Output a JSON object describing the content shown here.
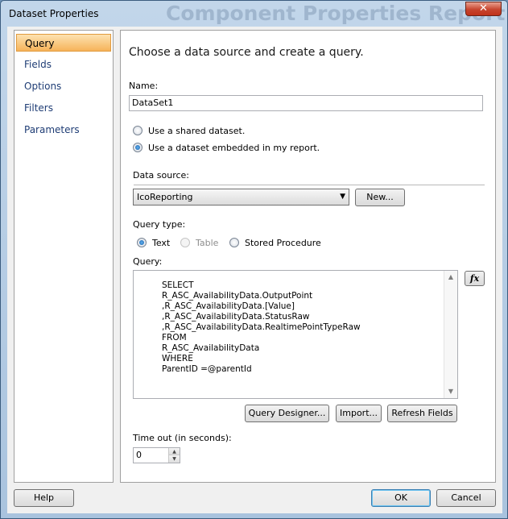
{
  "window": {
    "title": "Dataset Properties",
    "close": "✕",
    "background_title": "Component Properties Report"
  },
  "nav": {
    "items": [
      "Query",
      "Fields",
      "Options",
      "Filters",
      "Parameters"
    ]
  },
  "query": {
    "heading": "Choose a data source and create a query.",
    "name_label": "Name:",
    "name_value": "DataSet1",
    "shared_dataset_label": "Use a shared dataset.",
    "embedded_dataset_label": "Use a dataset embedded in my report.",
    "data_source_label": "Data source:",
    "data_source_value": "IcoReporting",
    "new_button": "New...",
    "query_type_label": "Query type:",
    "query_types": [
      "Text",
      "Table",
      "Stored Procedure"
    ],
    "query_label": "Query:",
    "query_text": "SELECT\nR_ASC_AvailabilityData.OutputPoint\n,R_ASC_AvailabilityData.[Value]\n,R_ASC_AvailabilityData.StatusRaw\n,R_ASC_AvailabilityData.RealtimePointTypeRaw\nFROM\nR_ASC_AvailabilityData\nWHERE\nParentID =@parentId",
    "fx_button": "fx",
    "query_designer_button": "Query Designer...",
    "import_button": "Import...",
    "refresh_fields_button": "Refresh Fields",
    "timeout_label": "Time out (in seconds):",
    "timeout_value": "0"
  },
  "footer": {
    "help": "Help",
    "ok": "OK",
    "cancel": "Cancel"
  }
}
